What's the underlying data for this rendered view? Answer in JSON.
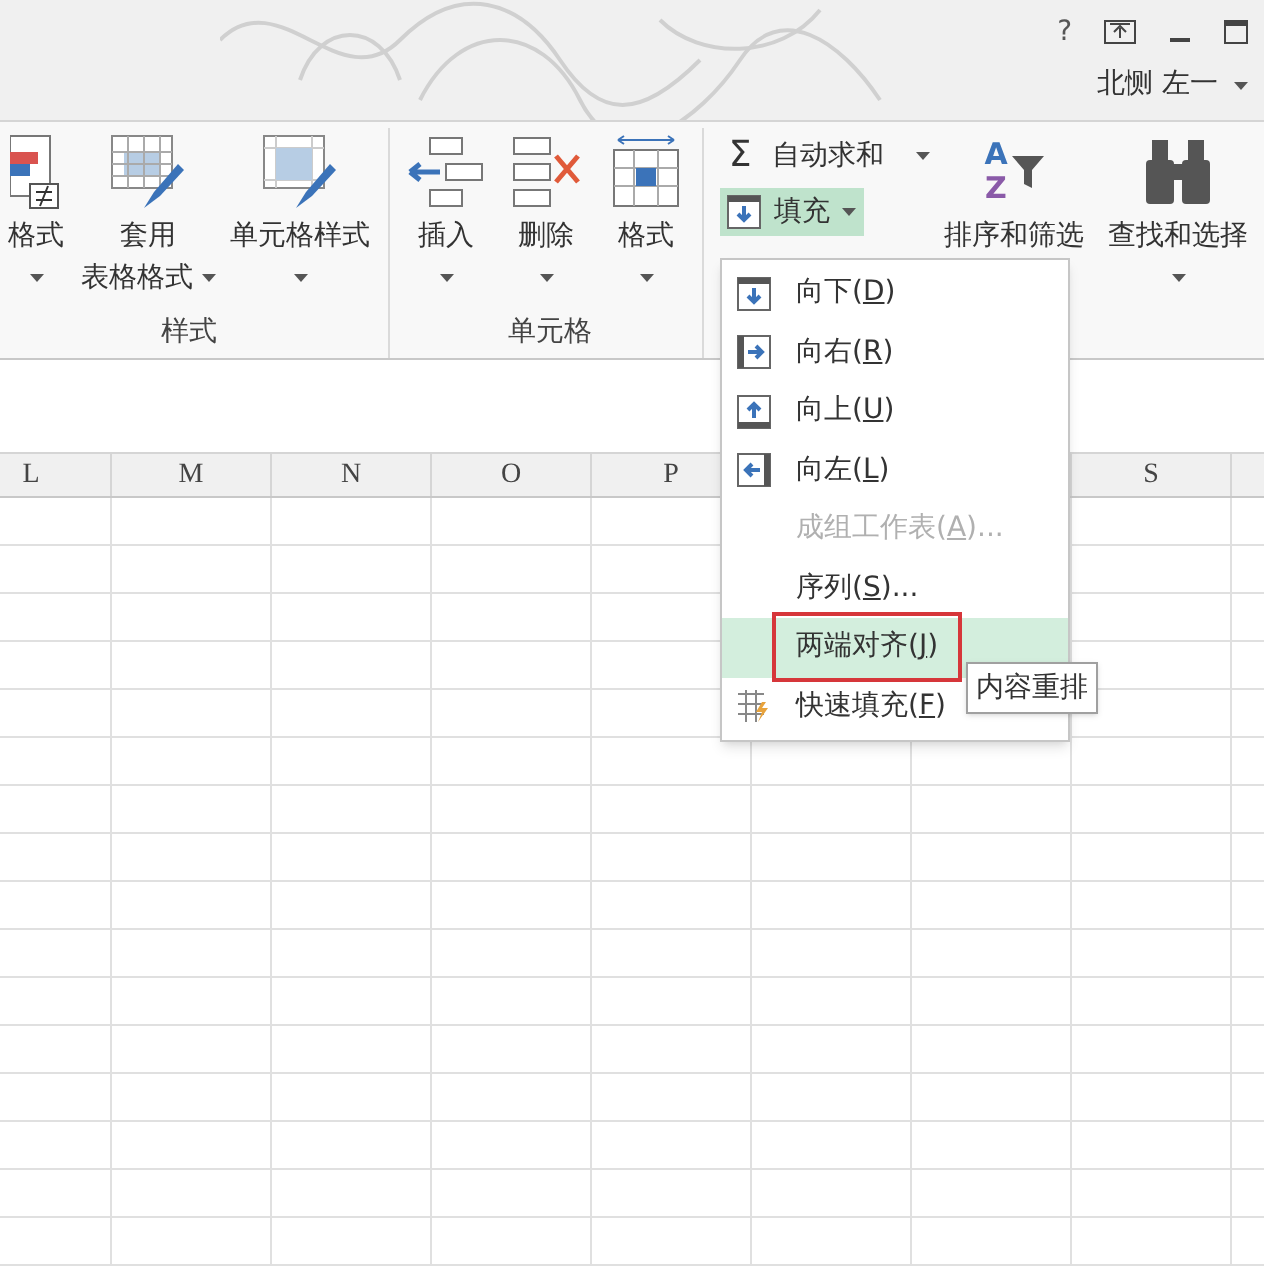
{
  "title_bar": {
    "help": "?",
    "user": "北恻 左一"
  },
  "ribbon": {
    "groups": [
      {
        "kind": "styles",
        "label": "样式",
        "buttons": [
          {
            "kind": "conditional",
            "label": "格式",
            "caret": true
          },
          {
            "kind": "table",
            "label": "套用",
            "label2": "表格格式",
            "caret": true
          },
          {
            "kind": "cellstyle",
            "label": "单元格样式",
            "caret": true
          }
        ]
      },
      {
        "kind": "cells",
        "label": "单元格",
        "buttons": [
          {
            "kind": "insert",
            "label": "插入",
            "caret": true
          },
          {
            "kind": "delete",
            "label": "删除",
            "caret": true
          },
          {
            "kind": "format",
            "label": "格式",
            "caret": true
          }
        ]
      },
      {
        "kind": "editing",
        "autosum": {
          "symbol": "Σ",
          "label": "自动求和"
        },
        "fill": {
          "label": "填充",
          "selected": true
        },
        "buttons": [
          {
            "kind": "sort",
            "label": "排序和筛选",
            "letters": [
              "A",
              "Z"
            ]
          },
          {
            "kind": "find",
            "label": "查找和选择",
            "caret": true
          }
        ]
      }
    ]
  },
  "columns_left": [
    "L",
    "M",
    "N",
    "O",
    "P"
  ],
  "columns_right": [
    "S"
  ],
  "fill_menu": {
    "items": [
      {
        "kind": "down",
        "before": "向下(",
        "key": "D",
        "after": ")",
        "disabled": false,
        "selected": false
      },
      {
        "kind": "right",
        "before": "向右(",
        "key": "R",
        "after": ")",
        "disabled": false,
        "selected": false
      },
      {
        "kind": "up",
        "before": "向上(",
        "key": "U",
        "after": ")",
        "disabled": false,
        "selected": false
      },
      {
        "kind": "left",
        "before": "向左(",
        "key": "L",
        "after": ")",
        "disabled": false,
        "selected": false
      },
      {
        "kind": "plain",
        "before": "成组工作表(",
        "key": "A",
        "after": ")...",
        "disabled": true,
        "selected": false
      },
      {
        "kind": "plain",
        "before": "序列(",
        "key": "S",
        "after": ")...",
        "disabled": false,
        "selected": false
      },
      {
        "kind": "plain",
        "before": "两端对齐(",
        "key": "J",
        "after": ")",
        "disabled": false,
        "selected": true
      },
      {
        "kind": "flash",
        "before": "快速填充(",
        "key": "F",
        "after": ")",
        "disabled": false,
        "selected": false
      }
    ]
  },
  "tooltip": "内容重排"
}
